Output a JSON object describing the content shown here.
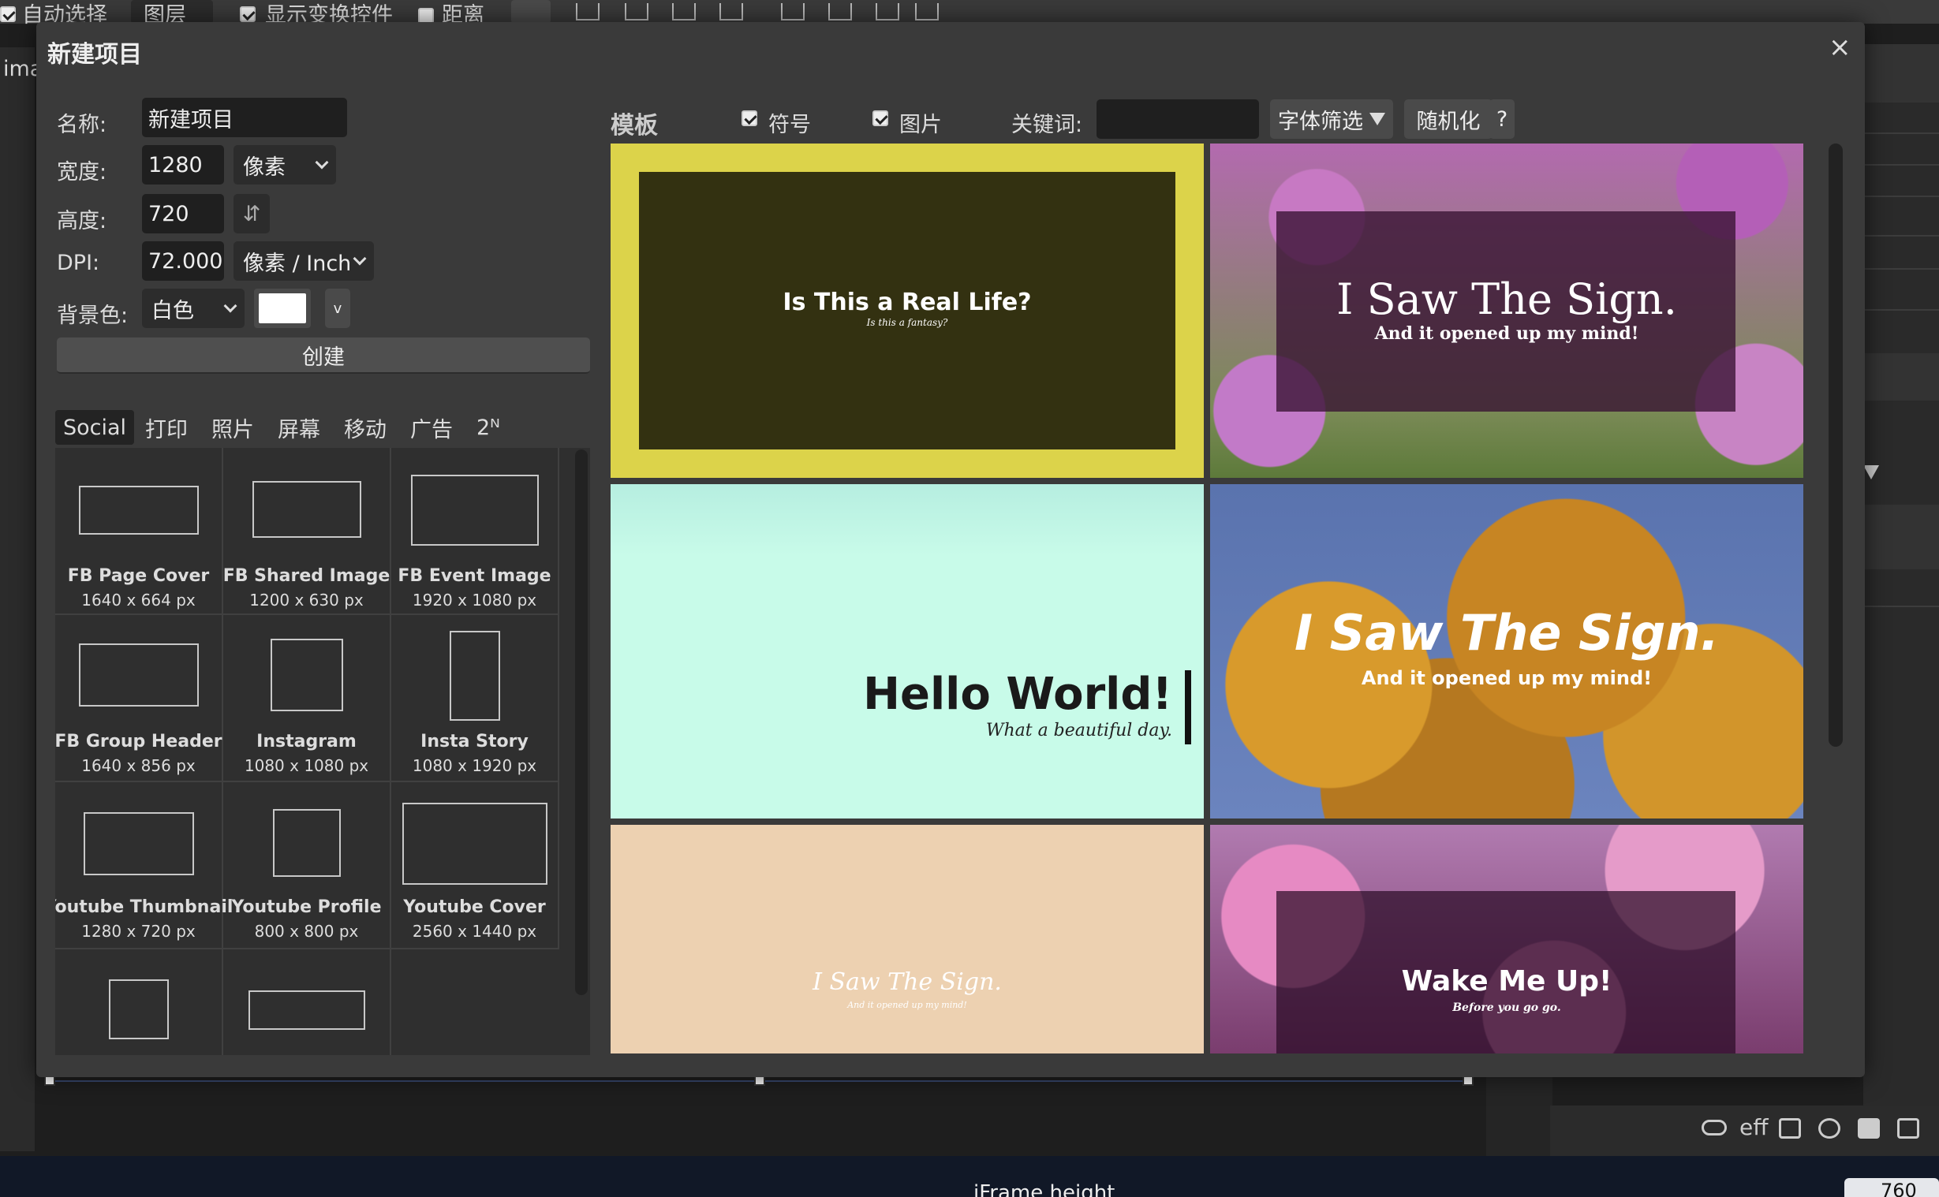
{
  "topbar": {
    "auto_select": "自动选择",
    "layer_select": "图层",
    "show_transform": "显示变换控件",
    "distance": "距离"
  },
  "sidebar": {
    "tab_text": "ima"
  },
  "dialog": {
    "title": "新建项目",
    "close": "×",
    "name_label": "名称:",
    "name_value": "新建项目",
    "width_label": "宽度:",
    "width_value": "1280",
    "width_unit": "像素",
    "height_label": "高度:",
    "height_value": "720",
    "swap_icon": "⇵",
    "dpi_label": "DPI:",
    "dpi_value": "72.000",
    "dpi_unit": "像素 / Inch",
    "bg_label": "背景色:",
    "bg_value": "白色",
    "bg_color": "#ffffff",
    "bg_dropdown_arrow": "v",
    "create": "创建",
    "tabs": [
      "Social",
      "打印",
      "照片",
      "屏幕",
      "移动",
      "广告",
      "2ᴺ"
    ],
    "presets": [
      {
        "name": "FB Page Cover",
        "size": "1640 x 664 px"
      },
      {
        "name": "FB Shared Image",
        "size": "1200 x 630 px"
      },
      {
        "name": "FB Event Image",
        "size": "1920 x 1080 px"
      },
      {
        "name": "FB Group Header",
        "size": "1640 x 856 px"
      },
      {
        "name": "Instagram",
        "size": "1080 x 1080 px"
      },
      {
        "name": "Insta Story",
        "size": "1080 x 1920 px"
      },
      {
        "name": "Youtube Thumbnail",
        "size": "1280 x 720 px"
      },
      {
        "name": "Youtube Profile",
        "size": "800 x 800 px"
      },
      {
        "name": "Youtube Cover",
        "size": "2560 x 1440 px"
      }
    ],
    "templates": {
      "heading": "模板",
      "symbols": "符号",
      "images": "图片",
      "keyword_label": "关键词:",
      "keyword_value": "",
      "font_filter": "字体筛选",
      "randomize": "随机化",
      "help": "?",
      "cards": [
        {
          "title": "Is This a Real Life?",
          "sub": "Is this a fantasy?"
        },
        {
          "title": "I Saw The Sign.",
          "sub": "And it opened up my mind!"
        },
        {
          "title": "Hello World!",
          "sub": "What a beautiful day."
        },
        {
          "title": "I Saw The Sign.",
          "sub": "And it opened up my mind!"
        },
        {
          "title": "I Saw The Sign.",
          "sub": "And it opened up my mind!"
        },
        {
          "title": "Wake Me Up!",
          "sub": "Before you go go."
        }
      ]
    }
  },
  "bottom": {
    "iframe_label": "iFrame height",
    "value": "760"
  },
  "colors": {
    "accent": "#dcd34a",
    "mint": "#c8fbe9",
    "peach": "#edd1b1"
  }
}
